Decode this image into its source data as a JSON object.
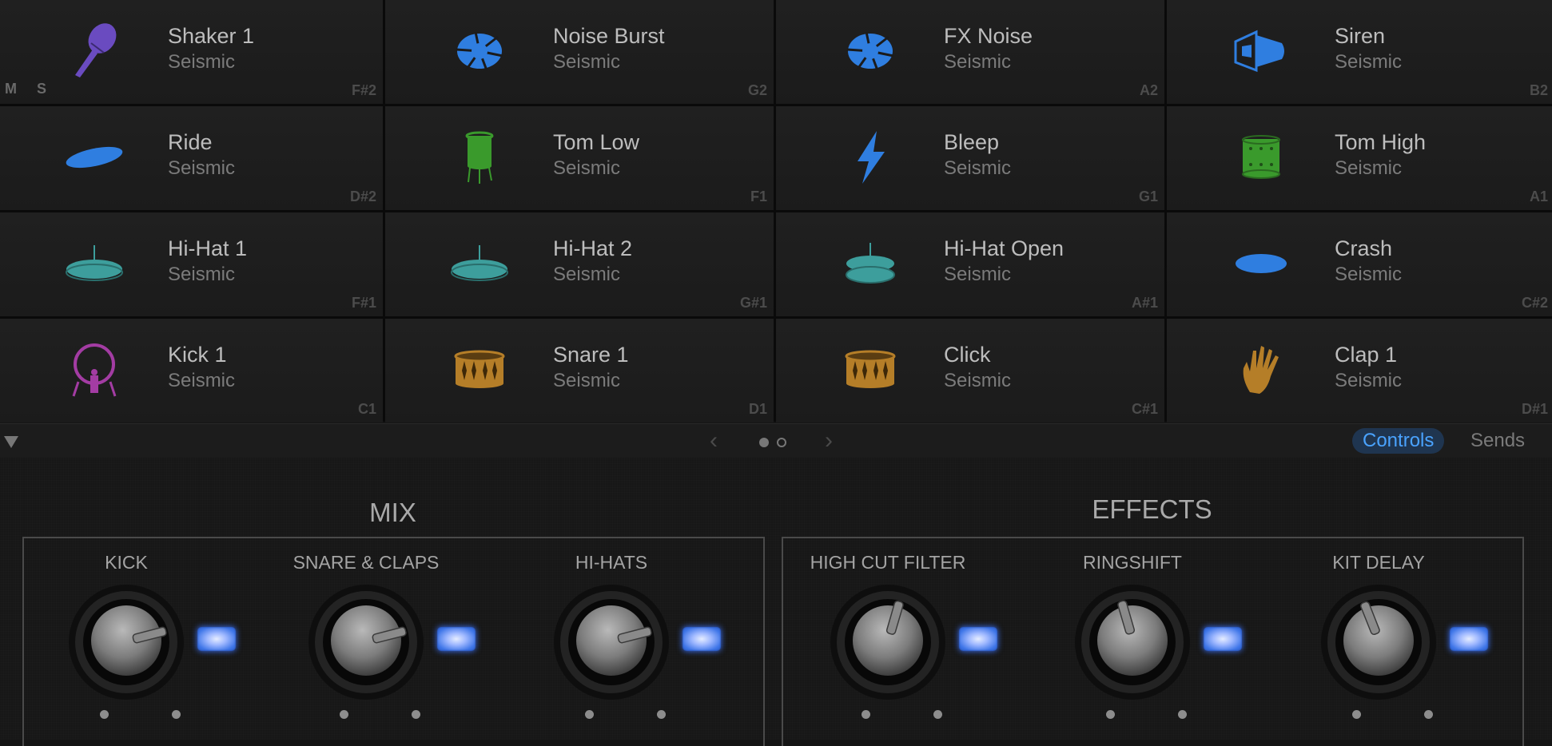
{
  "pads": [
    {
      "name": "Shaker 1",
      "kit": "Seismic",
      "note": "F#2",
      "icon": "maraca-icon",
      "color": "#6a4bc0",
      "show_ms": true,
      "mute_label": "M",
      "solo_label": "S"
    },
    {
      "name": "Noise Burst",
      "kit": "Seismic",
      "note": "G2",
      "icon": "burst-icon",
      "color": "#2f7ee0"
    },
    {
      "name": "FX Noise",
      "kit": "Seismic",
      "note": "A2",
      "icon": "burst-icon",
      "color": "#2f7ee0"
    },
    {
      "name": "Siren",
      "kit": "Seismic",
      "note": "B2",
      "icon": "megaphone-icon",
      "color": "#2f7ee0"
    },
    {
      "name": "Ride",
      "kit": "Seismic",
      "note": "D#2",
      "icon": "cymbal-icon",
      "color": "#2f7ee0"
    },
    {
      "name": "Tom Low",
      "kit": "Seismic",
      "note": "F1",
      "icon": "floor-tom-icon",
      "color": "#3a9a2c"
    },
    {
      "name": "Bleep",
      "kit": "Seismic",
      "note": "G1",
      "icon": "lightning-icon",
      "color": "#2f7ee0"
    },
    {
      "name": "Tom High",
      "kit": "Seismic",
      "note": "A1",
      "icon": "tom-icon",
      "color": "#3a9a2c"
    },
    {
      "name": "Hi-Hat 1",
      "kit": "Seismic",
      "note": "F#1",
      "icon": "hihat-icon",
      "color": "#3d9e9c"
    },
    {
      "name": "Hi-Hat 2",
      "kit": "Seismic",
      "note": "G#1",
      "icon": "hihat-icon",
      "color": "#3d9e9c"
    },
    {
      "name": "Hi-Hat Open",
      "kit": "Seismic",
      "note": "A#1",
      "icon": "hihat-open-icon",
      "color": "#3d9e9c"
    },
    {
      "name": "Crash",
      "kit": "Seismic",
      "note": "C#2",
      "icon": "crash-cymbal-icon",
      "color": "#2f7ee0"
    },
    {
      "name": "Kick 1",
      "kit": "Seismic",
      "note": "C1",
      "icon": "kick-drum-icon",
      "color": "#a33ca3"
    },
    {
      "name": "Snare 1",
      "kit": "Seismic",
      "note": "D1",
      "icon": "snare-drum-icon",
      "color": "#b57e28"
    },
    {
      "name": "Click",
      "kit": "Seismic",
      "note": "C#1",
      "icon": "snare-drum-icon",
      "color": "#b57e28"
    },
    {
      "name": "Clap 1",
      "kit": "Seismic",
      "note": "D#1",
      "icon": "clap-hand-icon",
      "color": "#b57e28"
    }
  ],
  "toolbar": {
    "prev_label": "‹",
    "next_label": "›",
    "page_count": 2,
    "current_page": 1,
    "tabs": [
      {
        "label": "Controls",
        "active": true
      },
      {
        "label": "Sends",
        "active": false
      }
    ],
    "accent": "#4aa3ff"
  },
  "mix": {
    "title": "MIX",
    "controls": [
      {
        "label": "KICK",
        "value": 0.78,
        "enabled": true
      },
      {
        "label": "SNARE & CLAPS",
        "value": 0.78,
        "enabled": true
      },
      {
        "label": "HI-HATS",
        "value": 0.78,
        "enabled": true
      }
    ]
  },
  "effects": {
    "title": "EFFECTS",
    "controls": [
      {
        "label": "HIGH CUT FILTER",
        "value": 0.56,
        "enabled": true
      },
      {
        "label": "RINGSHIFT",
        "value": 0.44,
        "enabled": true
      },
      {
        "label": "KIT DELAY",
        "value": 0.42,
        "enabled": true
      }
    ]
  }
}
